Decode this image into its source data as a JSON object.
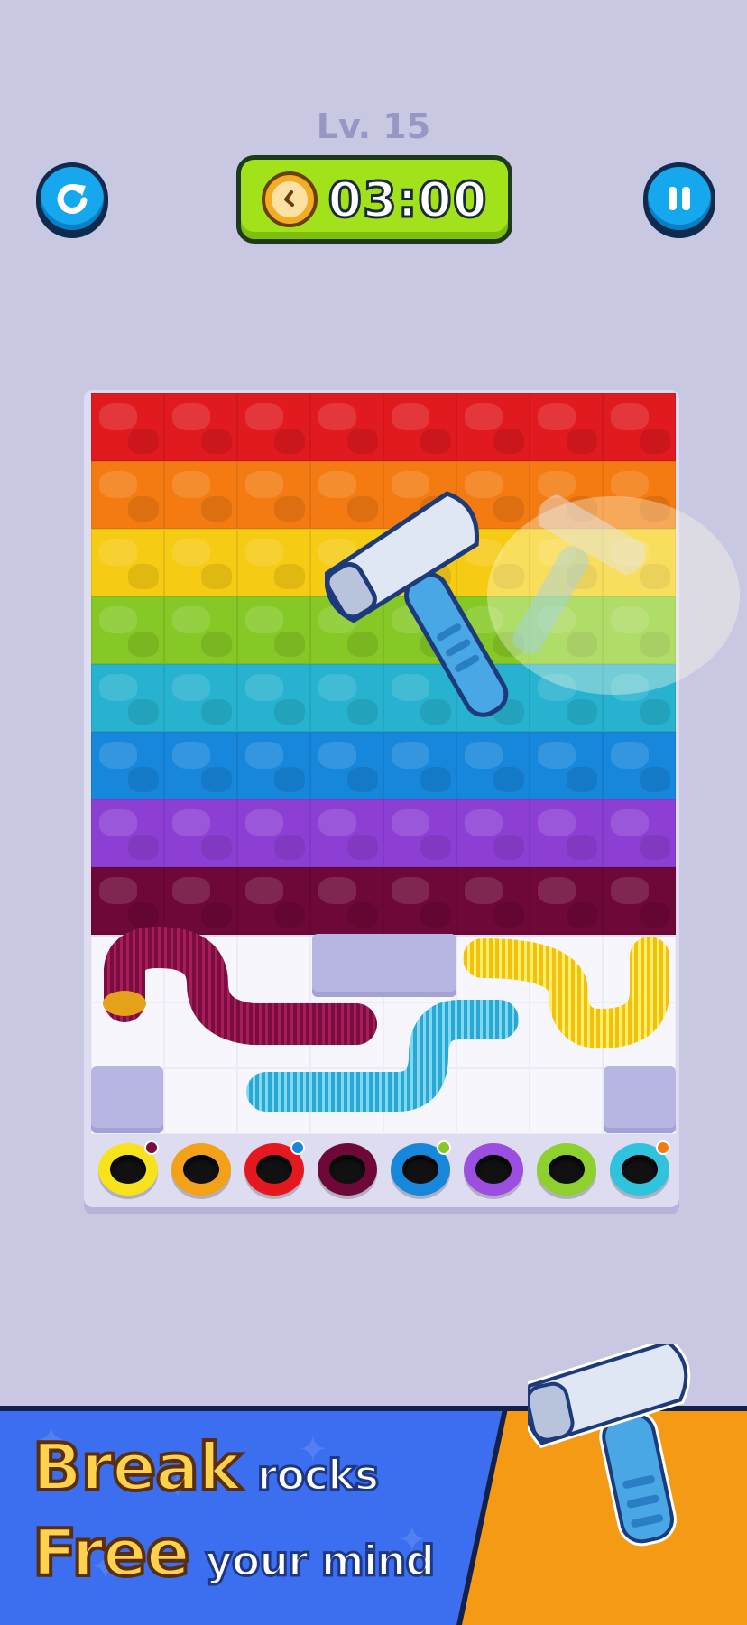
{
  "hud": {
    "level": "Lv. 15",
    "timer": "03:00",
    "icons": {
      "restart": "restart-icon",
      "pause": "pause-icon",
      "clock": "clock-icon"
    },
    "colors": {
      "button_blue": "#15a8ef",
      "timer_green": "#a2e21a"
    }
  },
  "board": {
    "rock_rows": [
      {
        "name": "red",
        "color": "#e01a1f"
      },
      {
        "name": "orange",
        "color": "#f37b12"
      },
      {
        "name": "yellow",
        "color": "#f6cb14"
      },
      {
        "name": "lime",
        "color": "#86c926"
      },
      {
        "name": "cyan",
        "color": "#27b3cf"
      },
      {
        "name": "blue",
        "color": "#1787dc"
      },
      {
        "name": "purple",
        "color": "#8d3fd4"
      },
      {
        "name": "maroon",
        "color": "#6d0838"
      }
    ],
    "rock_columns": 8,
    "springs": [
      {
        "name": "maroon-spring",
        "color": "#7a0d3f"
      },
      {
        "name": "cyan-spring",
        "color": "#3cb9df"
      },
      {
        "name": "yellow-spring",
        "color": "#f6d31c"
      }
    ],
    "holes": [
      {
        "name": "yellow",
        "color": "#f7e21b",
        "dot": "#7a0d3f"
      },
      {
        "name": "orange",
        "color": "#f4a11a",
        "dot": null
      },
      {
        "name": "red",
        "color": "#e5181f",
        "dot": "#1787dc"
      },
      {
        "name": "maroon",
        "color": "#6d0838",
        "dot": null
      },
      {
        "name": "blue",
        "color": "#1787dc",
        "dot": "#86c926"
      },
      {
        "name": "purple",
        "color": "#9b4ee0",
        "dot": null
      },
      {
        "name": "lime",
        "color": "#8ed12e",
        "dot": null
      },
      {
        "name": "cyan",
        "color": "#2fc3de",
        "dot": "#f37b12"
      }
    ]
  },
  "tool": {
    "icon": "hammer-icon"
  },
  "banner": {
    "line1_big": "Break",
    "line1_small": "rocks",
    "line2_big": "Free",
    "line2_small": "your mind",
    "colors": {
      "blue": "#3b6ff0",
      "orange": "#f59a15"
    }
  }
}
